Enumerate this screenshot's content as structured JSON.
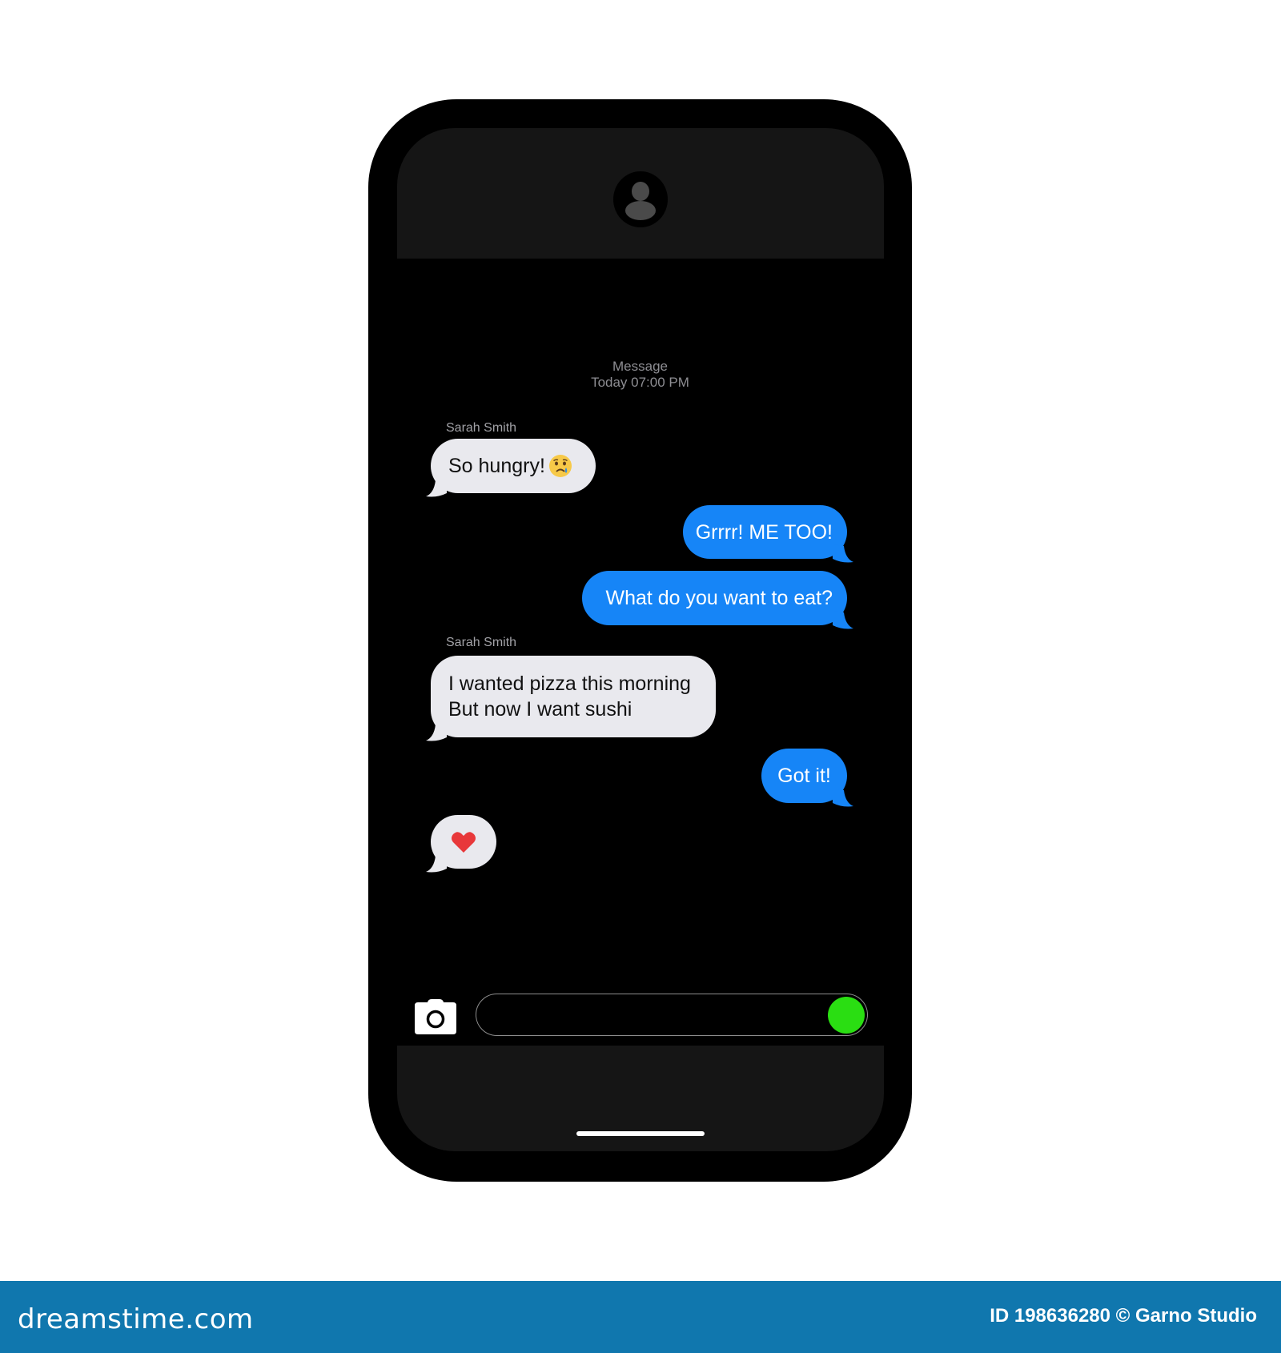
{
  "colors": {
    "incoming_bubble": "#e9e9ee",
    "outgoing_bubble": "#1685f7",
    "send_button": "#2ade12",
    "footer_background": "#1077ae",
    "heart": "#e8383a"
  },
  "header": {
    "avatar_icon": "person-silhouette"
  },
  "conversation": {
    "title": "Message",
    "timestamp": "Today 07:00 PM",
    "messages": [
      {
        "direction": "incoming",
        "sender": "Sarah Smith",
        "text": "So hungry!",
        "emoji": "crying-face"
      },
      {
        "direction": "outgoing",
        "text": "Grrrr! ME TOO!"
      },
      {
        "direction": "outgoing",
        "text": "What do you want to eat?"
      },
      {
        "direction": "incoming",
        "sender": "Sarah Smith",
        "lines": [
          "I wanted pizza this morning",
          "But now I want sushi"
        ]
      },
      {
        "direction": "outgoing",
        "text": "Got it!"
      },
      {
        "direction": "incoming",
        "emoji": "red-heart"
      }
    ]
  },
  "composer": {
    "camera_icon": "camera",
    "input_value": "",
    "send_icon": "green-circle"
  },
  "footer": {
    "logo": "dreamstime.com",
    "credit": "ID 198636280 © Garno Studio"
  }
}
